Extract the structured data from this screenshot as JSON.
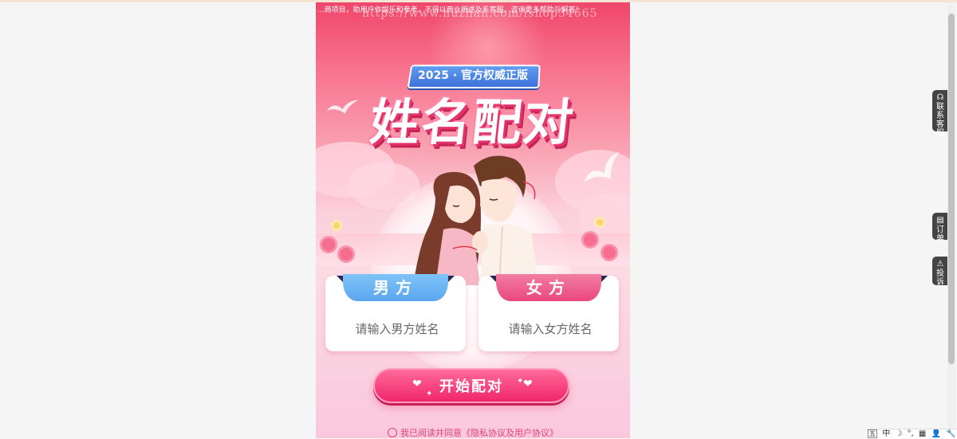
{
  "notice": "...商项目，助用户作娱乐和参考，不得以商业用途及系客服，咨询更多帮助与解答！",
  "watermark": "https://www.huzhan.com/ishop34665",
  "header": {
    "version_badge": "2025 · 官方权威正版",
    "title": "姓名配对"
  },
  "form": {
    "male": {
      "label": "男方",
      "placeholder": "请输入男方姓名",
      "value": ""
    },
    "female": {
      "label": "女方",
      "placeholder": "请输入女方姓名",
      "value": ""
    },
    "submit_label": "开始配对"
  },
  "agreement": {
    "prefix": "我已阅读并同意",
    "link": "《隐私协议及用户协议》"
  },
  "side_tabs": [
    {
      "icon": "headset-icon",
      "label": "联系客服"
    },
    {
      "icon": "order-icon",
      "label": "订单"
    },
    {
      "icon": "complaint-icon",
      "label": "投诉"
    }
  ],
  "ime_bar": [
    "五",
    "中",
    "☽",
    "°,",
    "▦",
    "👤",
    "🔧"
  ],
  "colors": {
    "male_accent": "#5aa6ef",
    "female_accent": "#e9467e",
    "button": "#f0266a",
    "agreement_text": "#e04578"
  }
}
